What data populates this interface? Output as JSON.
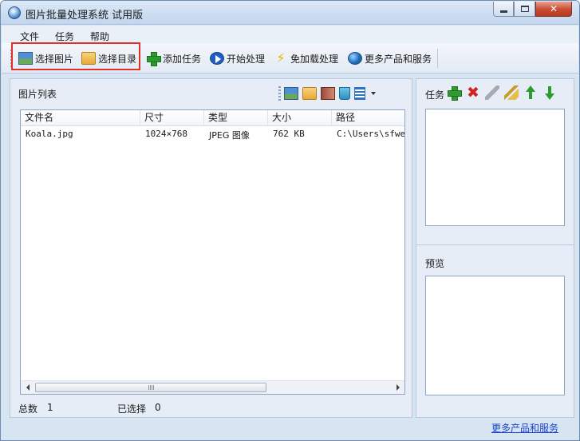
{
  "window": {
    "title": "图片批量处理系统 试用版"
  },
  "menu": {
    "items": [
      "文件",
      "任务",
      "帮助"
    ]
  },
  "toolbar": {
    "select_picture": "选择图片",
    "select_folder": "选择目录",
    "add_task": "添加任务",
    "start_process": "开始处理",
    "no_load_process": "免加载处理",
    "more_products": "更多产品和服务"
  },
  "image_list": {
    "title": "图片列表",
    "columns": [
      "文件名",
      "尺寸",
      "类型",
      "大小",
      "路径"
    ],
    "rows": [
      {
        "name": "Koala.jpg",
        "size": "1024×768",
        "type": "JPEG 图像",
        "filesize": "762 KB",
        "path": "C:\\Users\\sfwe\\D"
      }
    ],
    "status": {
      "total_label": "总数",
      "total_value": "1",
      "selected_label": "已选择",
      "selected_value": "0"
    }
  },
  "task_panel": {
    "label": "任务",
    "preview_label": "预览"
  },
  "footer": {
    "link": "更多产品和服务"
  },
  "colors": {
    "highlight": "#e0302a",
    "link": "#1a44c9",
    "panel_bg": "#e6edf6"
  }
}
